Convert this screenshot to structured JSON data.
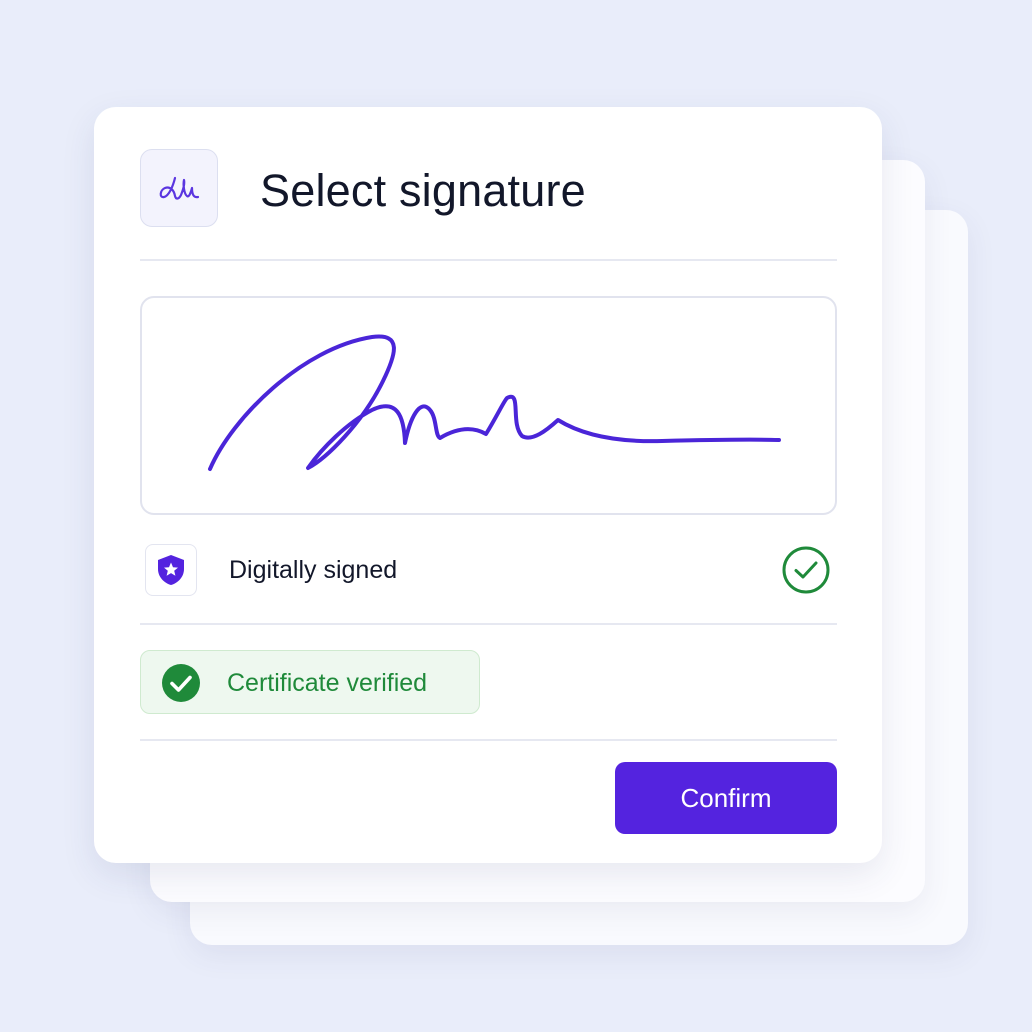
{
  "dialog": {
    "title": "Select signature",
    "header_icon": "signature-icon"
  },
  "signature_pad": {
    "stroke_color": "#4a25d8"
  },
  "signed_status": {
    "label": "Digitally signed",
    "icon": "shield-star-icon",
    "check_icon": "check-circle-icon"
  },
  "certificate": {
    "label": "Certificate verified",
    "icon": "check-filled-icon"
  },
  "actions": {
    "confirm_label": "Confirm"
  },
  "colors": {
    "accent": "#5423df",
    "success": "#1f8a3a",
    "background": "#e9edfa"
  }
}
